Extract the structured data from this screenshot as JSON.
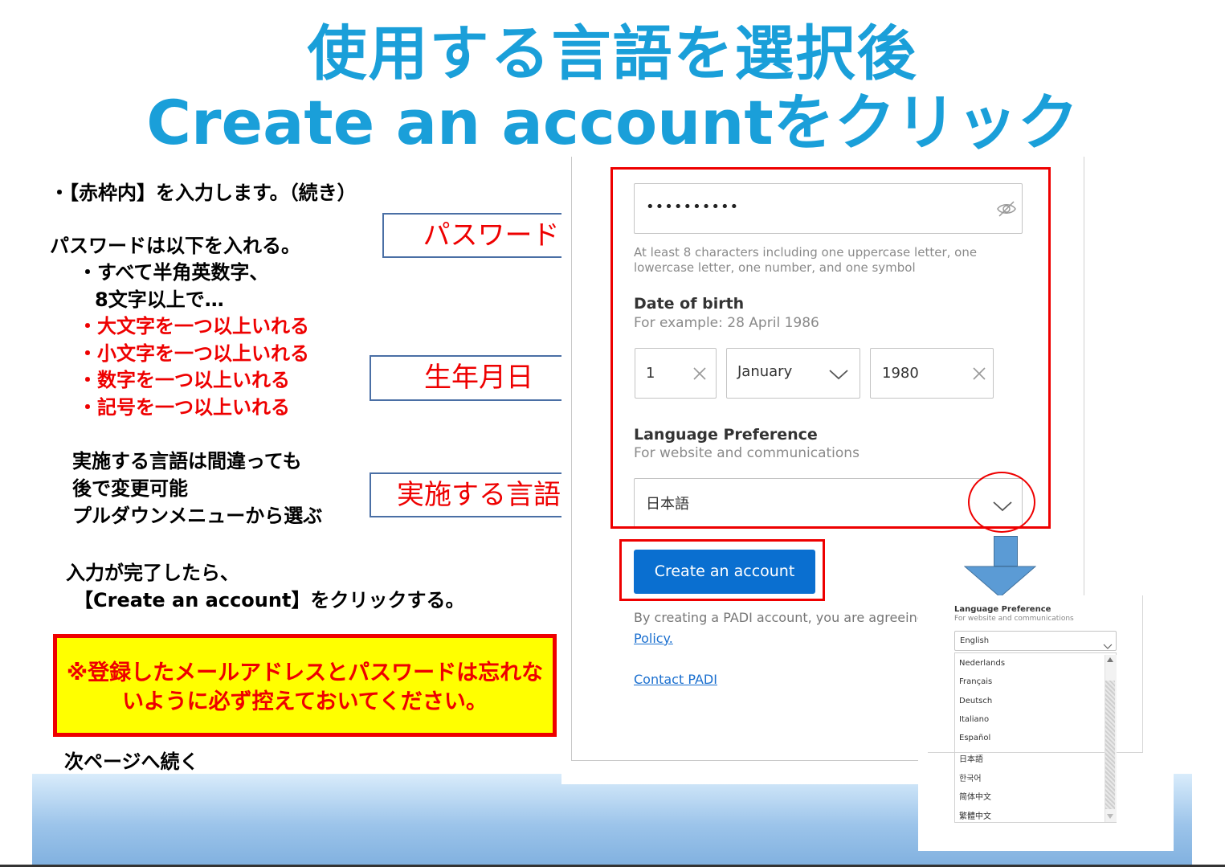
{
  "title": {
    "line1": "使用する言語を選択後",
    "line2": "Create an accountをクリック"
  },
  "instructions": {
    "intro": "・【赤枠内】を入力します。（続き）",
    "password_heading": "パスワードは以下を入れる。",
    "rule_halfwidth": "・すべて半角英数字、",
    "rule_length": "8文字以上で…",
    "rule_upper": "・大文字を一つ以上いれる",
    "rule_lower": "・小文字を一つ以上いれる",
    "rule_number": "・数字を一つ以上いれる",
    "rule_symbol": "・記号を一つ以上いれる",
    "lang_note1": "実施する言語は間違っても",
    "lang_note2": "後で変更可能",
    "lang_note3": "プルダウンメニューから選ぶ",
    "done_note1": "入力が完了したら、",
    "done_note2": "【Create an account】をクリックする。",
    "warning": "※登録したメールアドレスとパスワードは忘れないように必ず控えておいてください。",
    "continued": "次ページへ続く"
  },
  "labels": {
    "password": "パスワード",
    "birth": "生年月日",
    "language": "実施する言語"
  },
  "form": {
    "password_value": "••••••••••",
    "password_hint": "At least 8 characters including one uppercase letter, one lowercase letter, one number, and one symbol",
    "dob_label": "Date of birth",
    "dob_example": "For example: 28 April 1986",
    "dob_day": "1",
    "dob_month": "January",
    "dob_year": "1980",
    "lang_label": "Language Preference",
    "lang_sub": "For website and communications",
    "lang_value": "日本語",
    "create_button": "Create an account",
    "agree_text": "By creating a PADI account, you are agreeing",
    "policy_link": "Policy.",
    "contact_link": "Contact PADI"
  },
  "dropdown": {
    "label": "Language Preference",
    "sub": "For website and communications",
    "selected": "English",
    "options": [
      "Nederlands",
      "Français",
      "Deutsch",
      "Italiano",
      "Español",
      "日本語",
      "한국어",
      "简体中文",
      "繁體中文"
    ]
  },
  "colors": {
    "title": "#1a9fd9",
    "emphasis_red": "#ee0000",
    "button_blue": "#0a6fd0",
    "warning_bg": "#ffff00",
    "arrow": "#5b9bd5"
  }
}
